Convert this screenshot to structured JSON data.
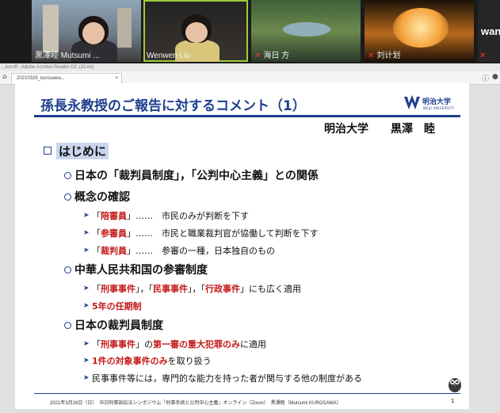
{
  "participants": [
    {
      "name": "黒澤睦 Mutsumi ...",
      "muted": false
    },
    {
      "name": "Wenwen Liu",
      "muted": false
    },
    {
      "name": "海日 方",
      "muted": true
    },
    {
      "name": "刘计划",
      "muted": true
    },
    {
      "name": "wan",
      "muted": true
    }
  ],
  "browser": {
    "title": "...kuroff - Adobe Acrobat Reader DC (32-bit)",
    "tab": "20210328_kurosawa..."
  },
  "slide": {
    "title": "孫長永教授のご報告に対するコメント（1）",
    "logo_name": "明治大学",
    "logo_sub": "MEIJI UNIVERSITY",
    "affiliation": "明治大学　　黒澤　睦",
    "heading": "はじめに",
    "s1": {
      "a": "日本の「裁判員制度」，「公判中心主義」との関係"
    },
    "s2": {
      "a": "概念の確認"
    },
    "s2_1": {
      "a": "「",
      "b": "陪審員",
      "c": "」……　市民のみが判断を下す"
    },
    "s2_2": {
      "a": "「",
      "b": "参審員",
      "c": "」……　市民と職業裁判官が協働して判断を下す"
    },
    "s2_3": {
      "a": "「",
      "b": "裁判員",
      "c": "」……　参審の一種，日本独自のもの"
    },
    "s3": {
      "a": "中華人民共和国の参審制度"
    },
    "s3_1": {
      "a": "「",
      "b": "刑事事件",
      "c": "」，「",
      "d": "民事事件",
      "e": "」，「",
      "f": "行政事件",
      "g": "」にも広く適用"
    },
    "s3_2": {
      "a": "5年の任期制"
    },
    "s4": {
      "a": "日本の裁判員制度"
    },
    "s4_1": {
      "a": "「",
      "b": "刑事事件",
      "c": "」の",
      "d": "第一審の重大犯罪のみ",
      "e": "に適用"
    },
    "s4_2": {
      "a": "1件の対象事件のみ",
      "b": "を取り扱う"
    },
    "s4_3": {
      "a": "民事事件等には，専門的な能力を持った者が関与する他の制度がある"
    },
    "footer": "2021年3月28日（日）　中日刑事訴訟法シンポジウム「刑事手続と公判中心主義」オンライン（Zoom）　黒澤睦（Mutsumi KUROSAWA）",
    "page_number": "1"
  },
  "colors": {
    "title_blue": "#1e3f8f",
    "emphasis_red": "#c41818",
    "heading_highlight": "#c9d6ee",
    "active_speaker": "#9ccc3a"
  }
}
